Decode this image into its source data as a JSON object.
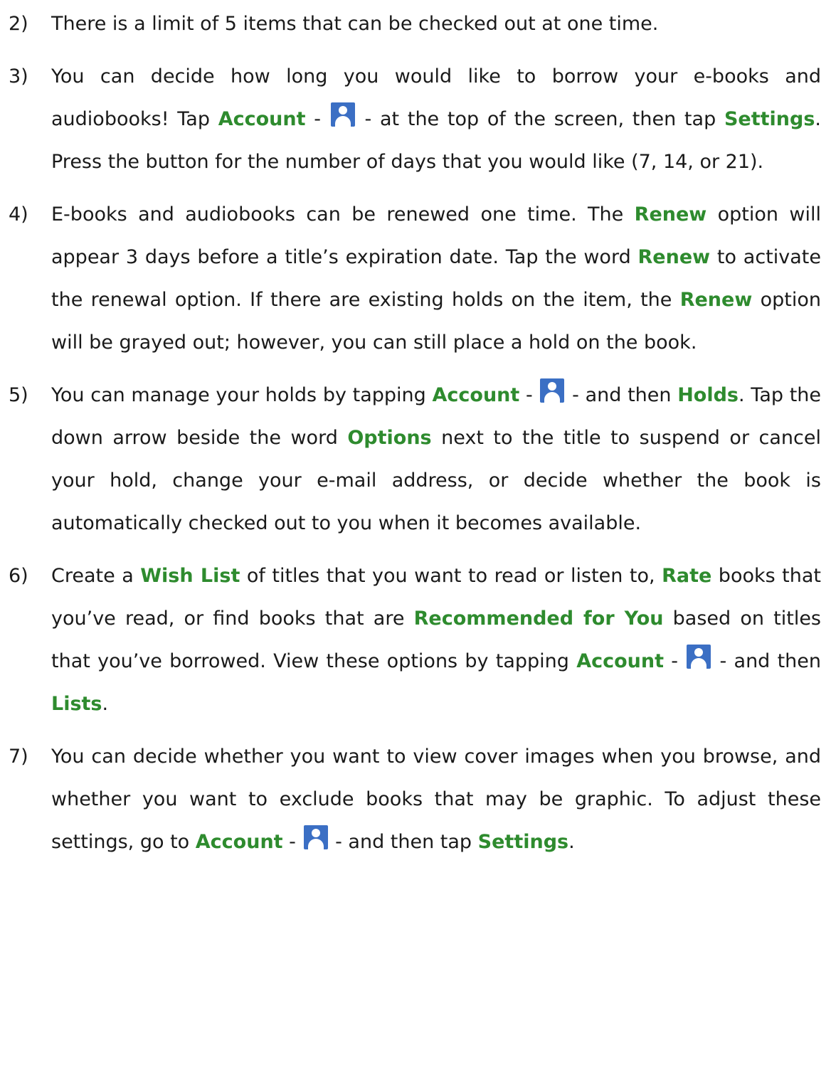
{
  "items": [
    {
      "num": "2)",
      "text": "There is a limit of 5 items that can be checked out at one time."
    },
    {
      "num": "3)",
      "t1": "You can decide how long you would like to borrow your e-books and audiobooks!  Tap ",
      "b1": "Account",
      "t2": " - ",
      "t3": " - at the top of the screen, then tap ",
      "b2": "Settings",
      "t4": ".  Press the button for the number of days that you would like (7, 14, or 21)."
    },
    {
      "num": "4)",
      "t1": "E-books and audiobooks can be renewed one time.  The ",
      "b1": "Renew",
      "t2": " option will appear 3 days before a title’s expiration date.  Tap the word ",
      "b2": "Renew",
      "t3": " to activate the renewal option.  If there are existing holds on the item, the ",
      "b3": "Renew",
      "t4": " option will be grayed out; however, you can still place a hold on the book."
    },
    {
      "num": "5)",
      "t1": "You can manage your holds by tapping ",
      "b1": "Account",
      "t2": " - ",
      "t3": " - and then ",
      "b2": "Holds",
      "t4": ".  Tap the down arrow beside the word ",
      "b3": "Options",
      "t5": " next to the title to suspend or cancel your hold, change your e-mail address, or decide whether the book is automatically checked out to you when it becomes available."
    },
    {
      "num": "6)",
      "t1": "Create a ",
      "b1": "Wish List",
      "t2": " of titles that you want to read or listen to, ",
      "b2": "Rate",
      "t3": " books that you’ve read, or find books that are ",
      "b3": "Recommended for You",
      "t4": " based on titles that you’ve borrowed.  View these options by tapping ",
      "b4": "Account",
      "t5": " - ",
      "t6": " - and then ",
      "b5": "Lists",
      "t7": "."
    },
    {
      "num": "7)",
      "t1": "You can decide whether you want to view cover images when you browse, and whether you want to exclude books that may be graphic.  To adjust these settings, go to ",
      "b1": "Account",
      "t2": " - ",
      "t3": " - and then tap ",
      "b2": "Settings",
      "t4": "."
    }
  ],
  "colors": {
    "highlight": "#2e8b2e",
    "icon": "#3b6fc4"
  },
  "icon_name": "account-user-icon"
}
